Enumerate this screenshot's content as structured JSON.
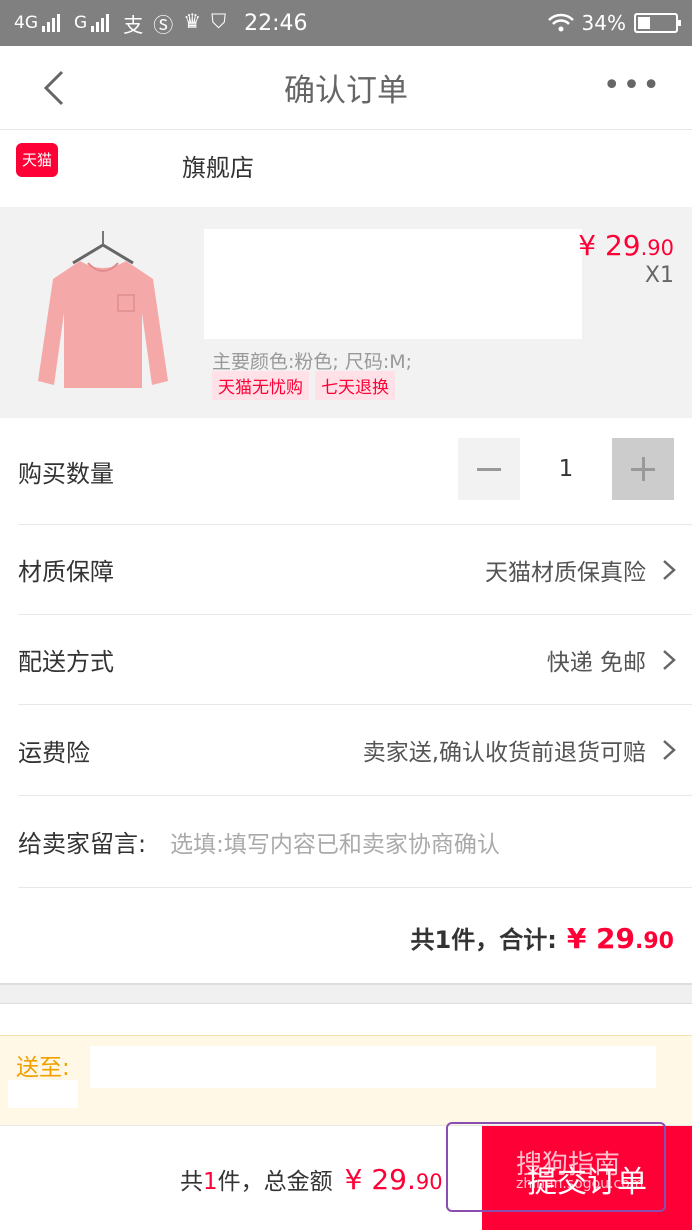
{
  "status_bar": {
    "network_1": "4G",
    "network_2": "G",
    "time": "22:46",
    "battery": "34%"
  },
  "nav": {
    "title": "确认订单",
    "more": "•••"
  },
  "shop": {
    "logo_text": "天猫",
    "name": "旗舰店"
  },
  "product": {
    "price_main": "¥ 29",
    "price_decimal": ".90",
    "quantity": "X1",
    "spec": "主要颜色:粉色; 尺码:M;",
    "tags": [
      "天猫无忧购",
      "七天退换"
    ]
  },
  "order": {
    "quantity_label": "购买数量",
    "quantity_value": "1",
    "material_label": "材质保障",
    "material_value": "天猫材质保真险",
    "delivery_label": "配送方式",
    "delivery_value": "快递 免邮",
    "freight_label": "运费险",
    "freight_value": "卖家送,确认收货前退货可赔",
    "message_label": "给卖家留言:",
    "message_placeholder": "选填:填写内容已和卖家协商确认",
    "summary_prefix": "共1件，合计:",
    "summary_main": "¥ 29",
    "summary_decimal": ".90"
  },
  "address": {
    "label": "送至:"
  },
  "bottom_bar": {
    "total_a": "共",
    "total_count": "1",
    "total_b": "件，总金额",
    "total_main": "¥ 29.",
    "total_decimal": "90",
    "submit_label": "提交订单"
  },
  "watermark": {
    "brand": "搜狗指南",
    "url": "zhinan.sogou.com"
  },
  "colors": {
    "accent": "#ff0036",
    "address_label": "#f0a000",
    "status_bar": "#808080"
  }
}
